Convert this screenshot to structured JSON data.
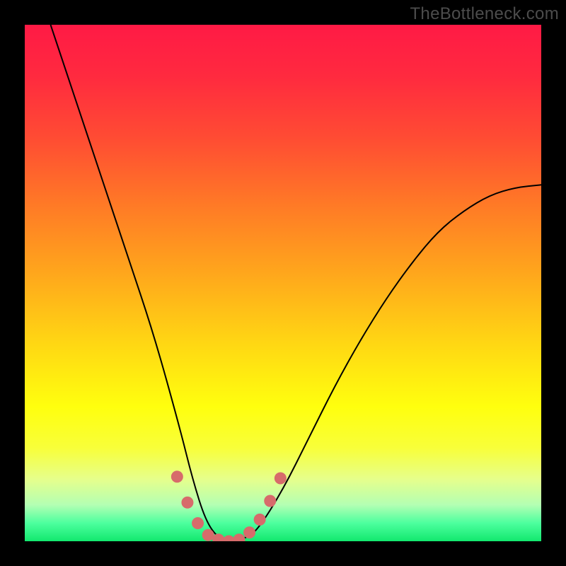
{
  "watermark": "TheBottleneck.com",
  "colors": {
    "gradient_stops": [
      {
        "offset": 0.0,
        "color": "#ff1a45"
      },
      {
        "offset": 0.1,
        "color": "#ff2a3f"
      },
      {
        "offset": 0.22,
        "color": "#ff4c33"
      },
      {
        "offset": 0.35,
        "color": "#ff7a26"
      },
      {
        "offset": 0.48,
        "color": "#ffa61c"
      },
      {
        "offset": 0.62,
        "color": "#ffd813"
      },
      {
        "offset": 0.74,
        "color": "#ffff0e"
      },
      {
        "offset": 0.82,
        "color": "#f8ff3a"
      },
      {
        "offset": 0.88,
        "color": "#e6ff8c"
      },
      {
        "offset": 0.93,
        "color": "#b3ffb3"
      },
      {
        "offset": 0.965,
        "color": "#4cff9e"
      },
      {
        "offset": 1.0,
        "color": "#12e86e"
      }
    ],
    "curve_stroke": "#000000",
    "marker_fill": "#d76b6b",
    "marker_stroke": "#d76b6b"
  },
  "chart_data": {
    "type": "line",
    "title": "",
    "xlabel": "",
    "ylabel": "",
    "xlim": [
      0,
      1
    ],
    "ylim": [
      0,
      1
    ],
    "series": [
      {
        "name": "bottleneck-curve",
        "x": [
          0.05,
          0.1,
          0.15,
          0.2,
          0.25,
          0.3,
          0.325,
          0.35,
          0.375,
          0.4,
          0.425,
          0.45,
          0.5,
          0.55,
          0.6,
          0.65,
          0.7,
          0.75,
          0.8,
          0.85,
          0.9,
          0.95,
          1.0
        ],
        "y": [
          1.0,
          0.85,
          0.7,
          0.55,
          0.4,
          0.22,
          0.12,
          0.04,
          0.005,
          0.0,
          0.005,
          0.02,
          0.1,
          0.2,
          0.3,
          0.39,
          0.47,
          0.54,
          0.6,
          0.64,
          0.67,
          0.685,
          0.69
        ]
      }
    ],
    "markers": {
      "name": "highlight-points",
      "x": [
        0.295,
        0.315,
        0.335,
        0.355,
        0.375,
        0.395,
        0.415,
        0.435,
        0.455,
        0.475,
        0.495
      ],
      "y": [
        0.125,
        0.075,
        0.035,
        0.012,
        0.003,
        0.0,
        0.003,
        0.017,
        0.042,
        0.078,
        0.122
      ]
    }
  }
}
